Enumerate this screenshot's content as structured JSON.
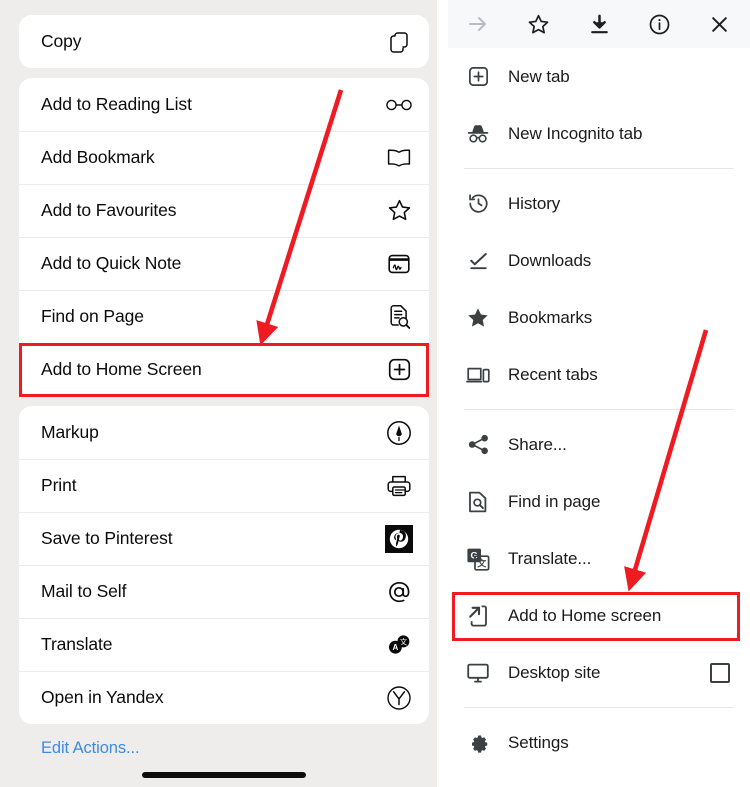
{
  "meta": {
    "accent_red": "#ee1b22",
    "ios_link_blue": "#3c8be0",
    "ios_bg": "#efedeb",
    "chrome_toolbar_bg": "#f7f8fa"
  },
  "ios_share_sheet": {
    "groups": [
      {
        "name": "copy-group",
        "rows": [
          {
            "label": "Copy",
            "icon": "copy-icon"
          }
        ]
      },
      {
        "name": "actions-group",
        "rows": [
          {
            "label": "Add to Reading List",
            "icon": "glasses-icon"
          },
          {
            "label": "Add Bookmark",
            "icon": "book-icon"
          },
          {
            "label": "Add to Favourites",
            "icon": "star-outline-icon"
          },
          {
            "label": "Add to Quick Note",
            "icon": "quick-note-icon"
          },
          {
            "label": "Find on Page",
            "icon": "find-on-page-icon"
          },
          {
            "label": "Add to Home Screen",
            "icon": "plus-square-icon",
            "highlighted": true
          }
        ]
      },
      {
        "name": "extensions-group",
        "rows": [
          {
            "label": "Markup",
            "icon": "markup-pen-icon"
          },
          {
            "label": "Print",
            "icon": "printer-icon"
          },
          {
            "label": "Save to Pinterest",
            "icon": "pinterest-icon"
          },
          {
            "label": "Mail to Self",
            "icon": "at-sign-icon"
          },
          {
            "label": "Translate",
            "icon": "translate-badge-icon"
          },
          {
            "label": "Open in Yandex",
            "icon": "yandex-icon"
          }
        ]
      }
    ],
    "edit_actions_label": "Edit Actions..."
  },
  "chrome_menu": {
    "toolbar": [
      {
        "name": "forward-arrow-icon",
        "label": "Forward",
        "disabled": true
      },
      {
        "name": "star-outline-icon",
        "label": "Bookmark"
      },
      {
        "name": "download-icon",
        "label": "Download"
      },
      {
        "name": "info-circle-icon",
        "label": "Page info"
      },
      {
        "name": "close-icon",
        "label": "Close"
      }
    ],
    "items": [
      {
        "label": "New tab",
        "icon": "new-tab-icon"
      },
      {
        "label": "New Incognito tab",
        "icon": "incognito-icon"
      },
      {
        "type": "separator"
      },
      {
        "label": "History",
        "icon": "history-icon"
      },
      {
        "label": "Downloads",
        "icon": "downloads-icon"
      },
      {
        "label": "Bookmarks",
        "icon": "star-filled-icon"
      },
      {
        "label": "Recent tabs",
        "icon": "recent-tabs-icon"
      },
      {
        "type": "separator"
      },
      {
        "label": "Share...",
        "icon": "share-icon"
      },
      {
        "label": "Find in page",
        "icon": "find-in-page-icon"
      },
      {
        "label": "Translate...",
        "icon": "google-translate-icon"
      },
      {
        "label": "Add to Home screen",
        "icon": "add-to-home-icon",
        "highlighted": true
      },
      {
        "label": "Desktop site",
        "icon": "desktop-icon",
        "checkbox": true,
        "checked": false
      },
      {
        "type": "separator"
      },
      {
        "label": "Settings",
        "icon": "gear-icon"
      }
    ]
  }
}
